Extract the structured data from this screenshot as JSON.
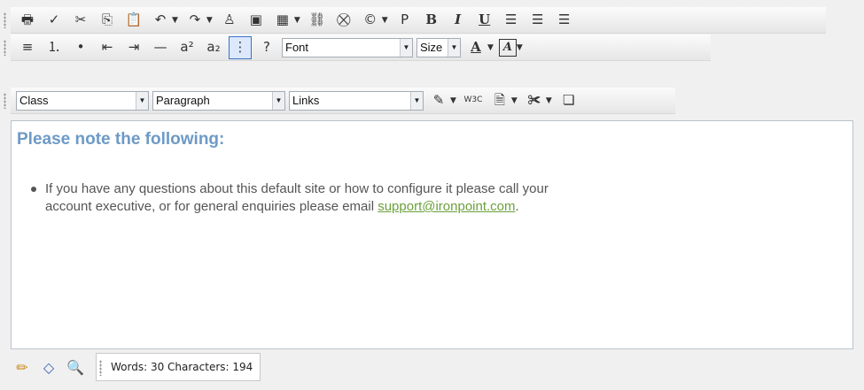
{
  "toolbar": {
    "row1": [
      {
        "name": "print-icon",
        "glyph": "🖶",
        "has_dropdown": false
      },
      {
        "name": "spellcheck-icon",
        "glyph": "✓",
        "has_dropdown": false
      },
      {
        "name": "cut-icon",
        "glyph": "✂",
        "has_dropdown": false
      },
      {
        "name": "copy-icon",
        "glyph": "⎘",
        "has_dropdown": false
      },
      {
        "name": "paste-icon",
        "glyph": "📋",
        "has_dropdown": false
      },
      {
        "name": "undo-icon",
        "glyph": "↶",
        "has_dropdown": true
      },
      {
        "name": "redo-icon",
        "glyph": "↷",
        "has_dropdown": true
      },
      {
        "name": "insert-symbol-icon",
        "glyph": "♙",
        "has_dropdown": false
      },
      {
        "name": "insert-image-icon",
        "glyph": "▣",
        "has_dropdown": false
      },
      {
        "name": "insert-table-icon",
        "glyph": "▦",
        "has_dropdown": true
      },
      {
        "name": "insert-link-icon",
        "glyph": "⛓",
        "has_dropdown": false
      },
      {
        "name": "remove-link-icon",
        "glyph": "⛒",
        "has_dropdown": false
      },
      {
        "name": "copyright-icon",
        "glyph": "©",
        "has_dropdown": true
      },
      {
        "name": "paragraph-icon",
        "glyph": "P",
        "has_dropdown": false
      },
      {
        "name": "bold-icon",
        "glyph": "B",
        "has_dropdown": false,
        "style": "bold"
      },
      {
        "name": "italic-icon",
        "glyph": "I",
        "has_dropdown": false,
        "style": "italic"
      },
      {
        "name": "underline-icon",
        "glyph": "U",
        "has_dropdown": false,
        "style": "under"
      },
      {
        "name": "align-left-icon",
        "glyph": "☰",
        "has_dropdown": false
      },
      {
        "name": "align-center-icon",
        "glyph": "☰",
        "has_dropdown": false
      },
      {
        "name": "align-right-icon",
        "glyph": "☰",
        "has_dropdown": false
      }
    ],
    "row2": [
      {
        "name": "justify-icon",
        "glyph": "≡",
        "has_dropdown": false
      },
      {
        "name": "numbered-list-icon",
        "glyph": "⒈",
        "has_dropdown": false
      },
      {
        "name": "bulleted-list-icon",
        "glyph": "•",
        "has_dropdown": false
      },
      {
        "name": "outdent-icon",
        "glyph": "⇤",
        "has_dropdown": false
      },
      {
        "name": "indent-icon",
        "glyph": "⇥",
        "has_dropdown": false
      },
      {
        "name": "horizontal-rule-icon",
        "glyph": "—",
        "has_dropdown": false
      },
      {
        "name": "superscript-icon",
        "glyph": "a²",
        "has_dropdown": false
      },
      {
        "name": "subscript-icon",
        "glyph": "a₂",
        "has_dropdown": false
      },
      {
        "name": "show-borders-icon",
        "glyph": "⋮",
        "has_dropdown": false,
        "style": "active"
      },
      {
        "name": "help-icon",
        "glyph": "?",
        "has_dropdown": false
      }
    ],
    "font_label": "Font",
    "size_label": "Size",
    "class_label": "Class",
    "paragraph_label": "Paragraph",
    "links_label": "Links",
    "fore_color_glyph": "A",
    "back_color_glyph": "A",
    "row3_icons": [
      {
        "name": "format-stripper-icon",
        "glyph": "✎",
        "has_dropdown": true
      },
      {
        "name": "w3c-validate-icon",
        "glyph": "W3C",
        "has_dropdown": false
      },
      {
        "name": "html-code-icon",
        "glyph": "🗎",
        "has_dropdown": true
      },
      {
        "name": "insert-snippet-icon",
        "glyph": "✀",
        "has_dropdown": true
      },
      {
        "name": "custom-tool-icon",
        "glyph": "❏",
        "has_dropdown": false
      }
    ]
  },
  "content": {
    "heading": "Please note the following:",
    "bullet_line1": "If you have any questions about this default site or how to configure it please call your",
    "bullet_line2_prefix": "account executive, or for general enquiries please email ",
    "email": "support@ironpoint.com",
    "bullet_line2_suffix": "."
  },
  "statusbar": {
    "modes": [
      {
        "name": "design-mode-icon",
        "glyph": "✏"
      },
      {
        "name": "html-mode-icon",
        "glyph": "◇"
      },
      {
        "name": "preview-mode-icon",
        "glyph": "🔍"
      }
    ],
    "stats": "Words: 30 Characters: 194"
  },
  "colors": {
    "heading": "#6d9ac6",
    "link": "#6aa13a",
    "active_border": "#3b72c8"
  }
}
